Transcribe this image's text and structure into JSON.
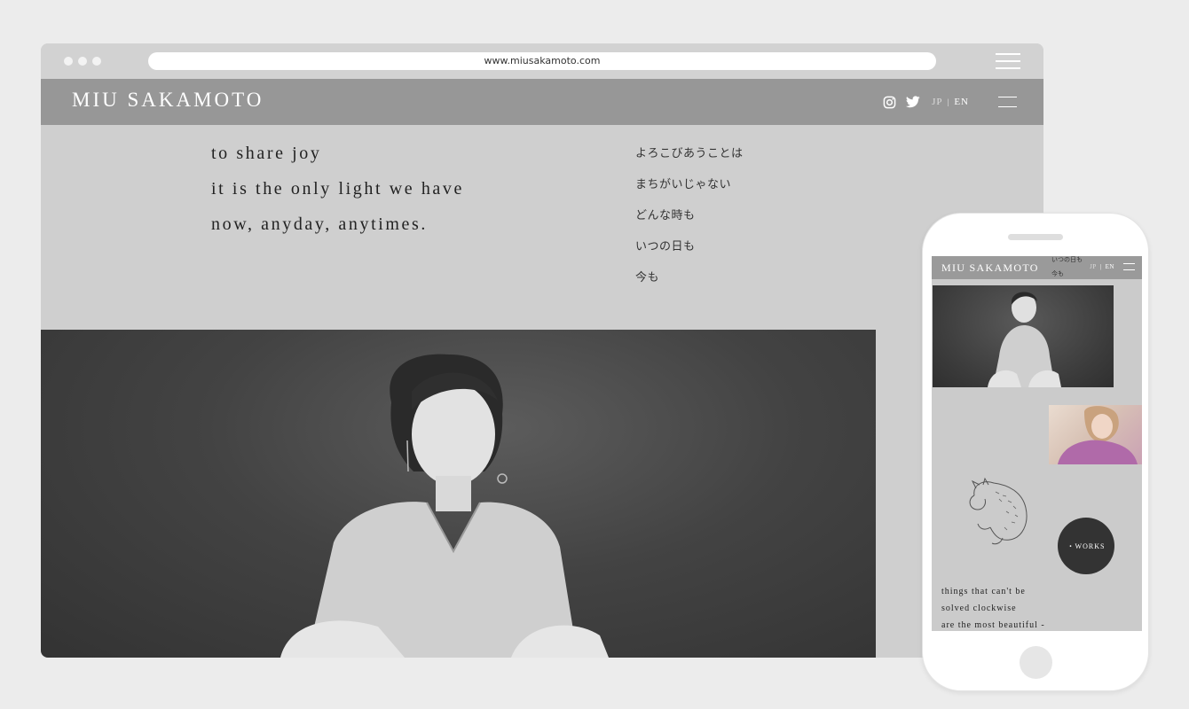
{
  "browser": {
    "url": "www.miusakamoto.com"
  },
  "site": {
    "brand": "MIU SAKAMOTO",
    "lang_jp": "JP",
    "lang_sep": "|",
    "lang_en": "EN",
    "hero_en": [
      "to share joy",
      "it is the only light we have",
      "now, anyday, anytimes."
    ],
    "hero_jp": [
      "よろこびあうことは",
      "まちがいじゃない",
      "どんな時も",
      "いつの日も",
      "今も"
    ]
  },
  "mobile": {
    "brand": "MIU SAKAMOTO",
    "lang_jp": "JP",
    "lang_sep": "|",
    "lang_en": "EN",
    "overlap_jp": [
      "いつの日も",
      "今も"
    ],
    "works_label": "・WORKS",
    "copy": [
      "things that can't be",
      "solved clockwise",
      "are the most beautiful -"
    ]
  },
  "icons": [
    "instagram-icon",
    "twitter-icon",
    "hamburger-menu-icon"
  ],
  "colors": {
    "page_bg": "#ececec",
    "chrome": "#d2d2d2",
    "header": "#979797",
    "content_bg": "#cfcfcf",
    "works_button": "#333333",
    "photo_accent": "#caa1b4"
  }
}
